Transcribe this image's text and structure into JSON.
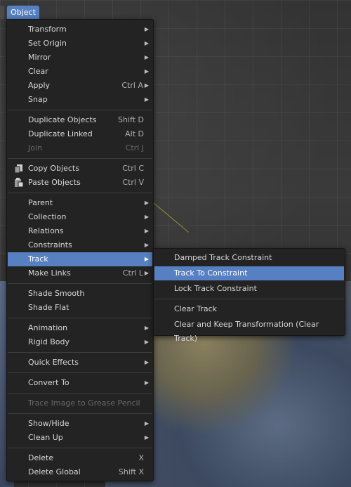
{
  "header": {
    "tab_label": "Object"
  },
  "menu": {
    "items": [
      {
        "label": "Transform",
        "shortcut": "",
        "submenu": true
      },
      {
        "label": "Set Origin",
        "shortcut": "",
        "submenu": true
      },
      {
        "label": "Mirror",
        "shortcut": "",
        "submenu": true
      },
      {
        "label": "Clear",
        "shortcut": "",
        "submenu": true
      },
      {
        "label": "Apply",
        "shortcut": "Ctrl A",
        "submenu": true
      },
      {
        "label": "Snap",
        "shortcut": "",
        "submenu": true
      },
      {
        "label": "Duplicate Objects",
        "shortcut": "Shift D",
        "submenu": false
      },
      {
        "label": "Duplicate Linked",
        "shortcut": "Alt D",
        "submenu": false
      },
      {
        "label": "Join",
        "shortcut": "Ctrl J",
        "submenu": false,
        "disabled": true
      },
      {
        "label": "Copy Objects",
        "shortcut": "Ctrl C",
        "submenu": false,
        "icon": "copy-icon"
      },
      {
        "label": "Paste Objects",
        "shortcut": "Ctrl V",
        "submenu": false,
        "icon": "paste-icon"
      },
      {
        "label": "Parent",
        "shortcut": "",
        "submenu": true
      },
      {
        "label": "Collection",
        "shortcut": "",
        "submenu": true
      },
      {
        "label": "Relations",
        "shortcut": "",
        "submenu": true
      },
      {
        "label": "Constraints",
        "shortcut": "",
        "submenu": true
      },
      {
        "label": "Track",
        "shortcut": "",
        "submenu": true,
        "active": true
      },
      {
        "label": "Make Links",
        "shortcut": "Ctrl L",
        "submenu": true
      },
      {
        "label": "Shade Smooth",
        "shortcut": "",
        "submenu": false
      },
      {
        "label": "Shade Flat",
        "shortcut": "",
        "submenu": false
      },
      {
        "label": "Animation",
        "shortcut": "",
        "submenu": true
      },
      {
        "label": "Rigid Body",
        "shortcut": "",
        "submenu": true
      },
      {
        "label": "Quick Effects",
        "shortcut": "",
        "submenu": true
      },
      {
        "label": "Convert To",
        "shortcut": "",
        "submenu": true
      },
      {
        "label": "Trace Image to Grease Pencil",
        "shortcut": "",
        "submenu": false,
        "disabled": true
      },
      {
        "label": "Show/Hide",
        "shortcut": "",
        "submenu": true
      },
      {
        "label": "Clean Up",
        "shortcut": "",
        "submenu": true
      },
      {
        "label": "Delete",
        "shortcut": "X",
        "submenu": false
      },
      {
        "label": "Delete Global",
        "shortcut": "Shift X",
        "submenu": false
      }
    ]
  },
  "track_submenu": {
    "items": [
      {
        "label": "Damped Track Constraint"
      },
      {
        "label": "Track To Constraint",
        "active": true
      },
      {
        "label": "Lock Track Constraint"
      },
      {
        "label": "Clear Track"
      },
      {
        "label": "Clear and Keep Transformation (Clear Track)"
      }
    ]
  },
  "colors": {
    "accent": "#5680c2",
    "menu_bg": "#232323"
  }
}
